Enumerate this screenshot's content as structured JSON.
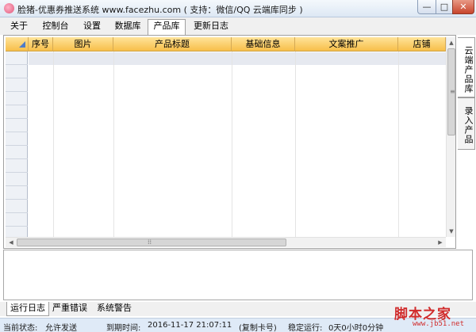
{
  "window": {
    "title": "脸猪-优惠券推送系统 www.facezhu.com ( 支持：微信/QQ 云端库同步 )",
    "minimize": "—",
    "maximize": "□",
    "close": "✕"
  },
  "menu": {
    "items": [
      "关于",
      "控制台",
      "设置",
      "数据库",
      "产品库",
      "更新日志"
    ],
    "active": "产品库"
  },
  "grid": {
    "columns": [
      "序号",
      "图片",
      "产品标题",
      "基础信息",
      "文案推广",
      "店铺"
    ],
    "rows": []
  },
  "side_tabs": [
    "云端产品库",
    "录入产品"
  ],
  "log_tabs": {
    "items": [
      "运行日志",
      "严重错误",
      "系统警告"
    ],
    "active": "运行日志"
  },
  "status": {
    "current_state_label": "当前状态:",
    "current_state_value": "允许发送",
    "expire_label": "到期时间:",
    "expire_value": "2016-11-17 21:07:11",
    "expire_note": "(复制卡号)",
    "uptime_label": "稳定运行:",
    "uptime_value": "0天0小时0分钟"
  },
  "watermark": {
    "text": "脚本之家",
    "url": "www.jb51.net"
  }
}
